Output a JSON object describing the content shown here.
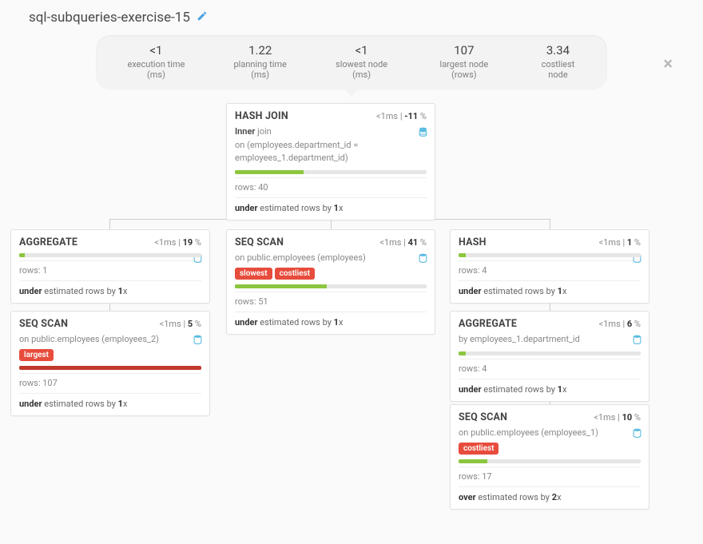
{
  "title": "sql-subqueries-exercise-15",
  "stats": [
    {
      "val": "<1",
      "lbl": "execution time (ms)"
    },
    {
      "val": "1.22",
      "lbl": "planning time (ms)"
    },
    {
      "val": "<1",
      "lbl": "slowest node (ms)"
    },
    {
      "val": "107",
      "lbl": "largest node (rows)"
    },
    {
      "val": "3.34",
      "lbl": "costliest node"
    }
  ],
  "nodes": {
    "hashjoin": {
      "title": "HASH JOIN",
      "ms": "<1",
      "pct": "-11",
      "line1a": "Inner",
      "line1b": "join",
      "line2": "on (employees.department_id = employees_1.department_id)",
      "rows": "40",
      "bar": 36,
      "est_a": "under",
      "est_b": "estimated rows by",
      "est_c": "1",
      "est_d": "x"
    },
    "agg1": {
      "title": "AGGREGATE",
      "ms": "<1",
      "pct": "19",
      "rows": "1",
      "bar": 3,
      "est_a": "under",
      "est_b": "estimated rows by",
      "est_c": "1",
      "est_d": "x"
    },
    "seq2": {
      "title": "SEQ SCAN",
      "ms": "<1",
      "pct": "5",
      "on": "on public.employees (employees_2)",
      "tags": [
        "largest"
      ],
      "rows": "107",
      "bar": 100,
      "barcolor": "red",
      "est_a": "under",
      "est_b": "estimated rows by",
      "est_c": "1",
      "est_d": "x"
    },
    "seqmain": {
      "title": "SEQ SCAN",
      "ms": "<1",
      "pct": "41",
      "on": "on public.employees (employees)",
      "tags": [
        "slowest",
        "costliest"
      ],
      "rows": "51",
      "bar": 48,
      "barcolor": "green",
      "est_a": "under",
      "est_b": "estimated rows by",
      "est_c": "1",
      "est_d": "x"
    },
    "hash": {
      "title": "HASH",
      "ms": "<1",
      "pct": "1",
      "rows": "4",
      "bar": 4,
      "est_a": "under",
      "est_b": "estimated rows by",
      "est_c": "1",
      "est_d": "x"
    },
    "agg2": {
      "title": "AGGREGATE",
      "ms": "<1",
      "pct": "6",
      "by": "by employees_1.department_id",
      "rows": "4",
      "bar": 4,
      "est_a": "under",
      "est_b": "estimated rows by",
      "est_c": "1",
      "est_d": "x"
    },
    "seq1": {
      "title": "SEQ SCAN",
      "ms": "<1",
      "pct": "10",
      "on": "on public.employees (employees_1)",
      "tags": [
        "costliest"
      ],
      "rows": "17",
      "bar": 16,
      "barcolor": "green",
      "est_a": "over",
      "est_b": "estimated rows by",
      "est_c": "2",
      "est_d": "x"
    }
  },
  "rows_label": "rows:"
}
